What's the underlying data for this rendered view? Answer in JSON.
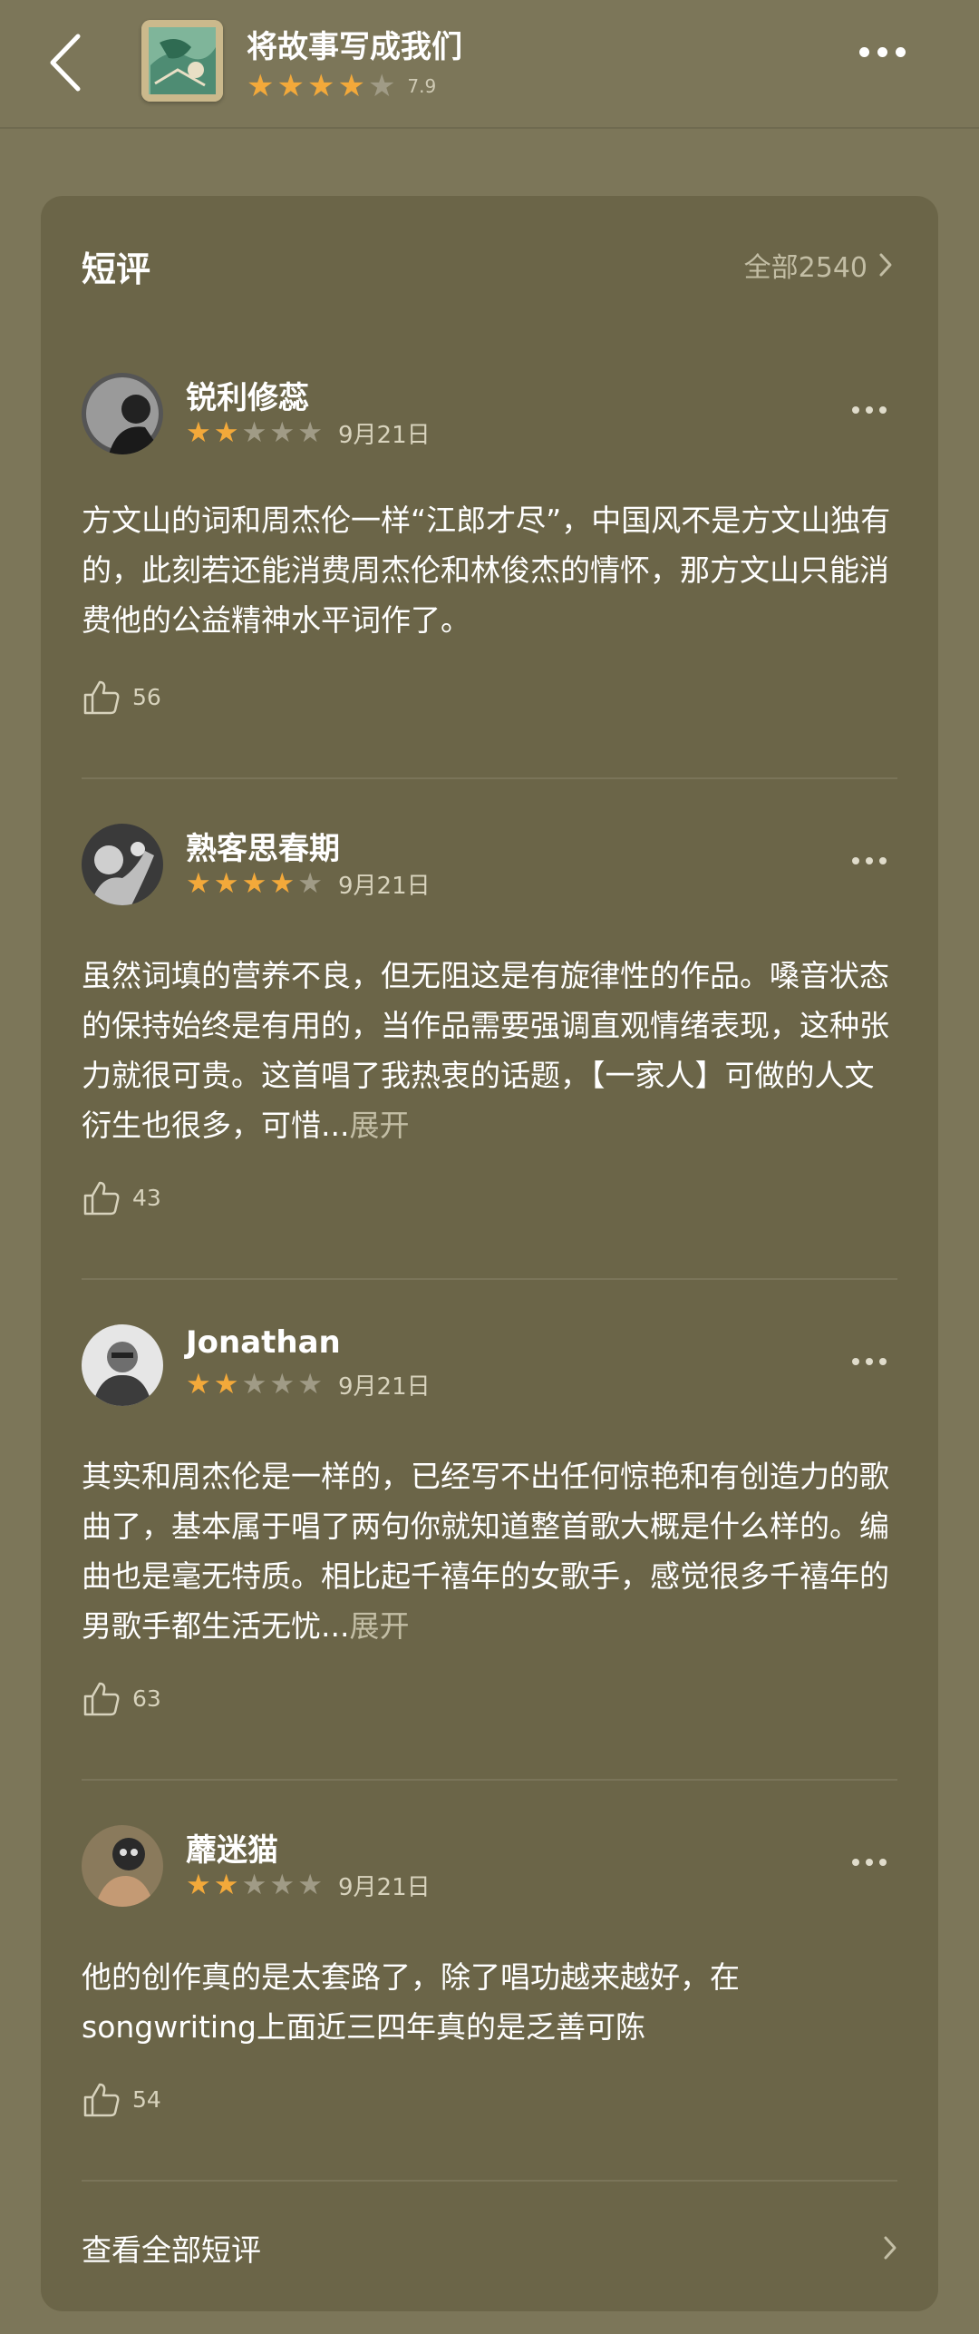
{
  "header": {
    "title": "将故事写成我们",
    "rating": 4,
    "score": "7.9"
  },
  "section": {
    "title": "短评",
    "all_label": "全部2540"
  },
  "reviews": [
    {
      "name": "锐利修蕊",
      "stars": 2,
      "date": "9月21日",
      "text": "方文山的词和周杰伦一样“江郎才尽”，中国风不是方文山独有的，此刻若还能消费周杰伦和林俊杰的情怀，那方文山只能消费他的公益精神水平词作了。",
      "expand": "",
      "likes": "56"
    },
    {
      "name": "熟客思春期",
      "stars": 4,
      "date": "9月21日",
      "text": "虽然词填的营养不良，但无阻这是有旋律性的作品。嗓音状态的保持始终是有用的，当作品需要强调直观情绪表现，这种张力就很可贵。这首唱了我热衷的话题，【一家人】可做的人文衍生也很多，可惜...",
      "expand": "展开",
      "likes": "43"
    },
    {
      "name": "Jonathan",
      "stars": 2,
      "date": "9月21日",
      "text": "其实和周杰伦是一样的，已经写不出任何惊艳和有创造力的歌曲了，基本属于唱了两句你就知道整首歌大概是什么样的。编曲也是毫无特质。相比起千禧年的女歌手，感觉很多千禧年的男歌手都生活无忧...",
      "expand": "展开",
      "likes": "63"
    },
    {
      "name": "蘼迷猫",
      "stars": 2,
      "date": "9月21日",
      "text": "他的创作真的是太套路了，除了唱功越来越好，在songwriting上面近三四年真的是乏善可陈",
      "expand": "",
      "likes": "54"
    }
  ],
  "footer": {
    "label": "查看全部短评"
  },
  "colors": {
    "background": "#7c7659",
    "card": "#6b6548",
    "star_on": "#f3a93a",
    "star_off": "#a09b86"
  }
}
